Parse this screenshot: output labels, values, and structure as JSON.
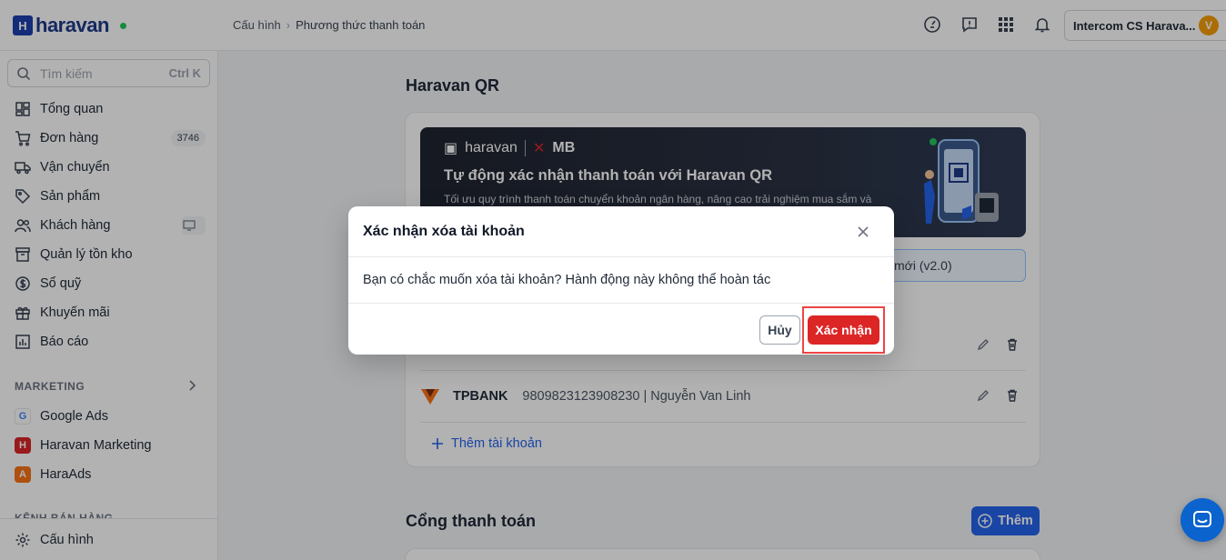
{
  "header": {
    "logo_text": "haravan",
    "breadcrumb": [
      "Cấu hình",
      "Phương thức thanh toán"
    ],
    "account_name": "Intercom CS Harava...",
    "avatar_letter": "V"
  },
  "sidebar": {
    "search_placeholder": "Tìm kiếm",
    "search_shortcut": "Ctrl K",
    "items": [
      {
        "label": "Tổng quan"
      },
      {
        "label": "Đơn hàng",
        "badge": "3746"
      },
      {
        "label": "Vận chuyển"
      },
      {
        "label": "Sản phẩm"
      },
      {
        "label": "Khách hàng"
      },
      {
        "label": "Quản lý tồn kho"
      },
      {
        "label": "Sổ quỹ"
      },
      {
        "label": "Khuyến mãi"
      },
      {
        "label": "Báo cáo"
      }
    ],
    "marketing_label": "MARKETING",
    "marketing_items": [
      {
        "label": "Google Ads"
      },
      {
        "label": "Haravan Marketing"
      },
      {
        "label": "HaraAds"
      }
    ],
    "sales_channel_label": "KÊNH BÁN HÀNG",
    "settings_label": "Cấu hình"
  },
  "main": {
    "qr_title": "Haravan QR",
    "banner": {
      "brand": "haravan",
      "partner": "MB",
      "title": "Tự động xác nhận thanh toán với Haravan QR",
      "desc": "Tối ưu quy trình thanh toán chuyển khoản ngân hàng, nâng cao trải nghiệm mua sắm và"
    },
    "v2_button": "mới (v2.0)",
    "accounts": [
      {
        "bank": "TPBANK",
        "detail": "9809823123908230 | Nguyễn Van Linh"
      }
    ],
    "add_account": "Thêm tài khoản",
    "gateway_title": "Cổng thanh toán",
    "add_gateway": "Thêm"
  },
  "modal": {
    "title": "Xác nhận xóa tài khoản",
    "message": "Bạn có chắc muốn xóa tài khoản? Hành động này không thể hoàn tác",
    "cancel": "Hủy",
    "confirm": "Xác nhận"
  },
  "colors": {
    "primary": "#2563eb",
    "danger": "#dc2626",
    "brand": "#1e3a8a"
  }
}
